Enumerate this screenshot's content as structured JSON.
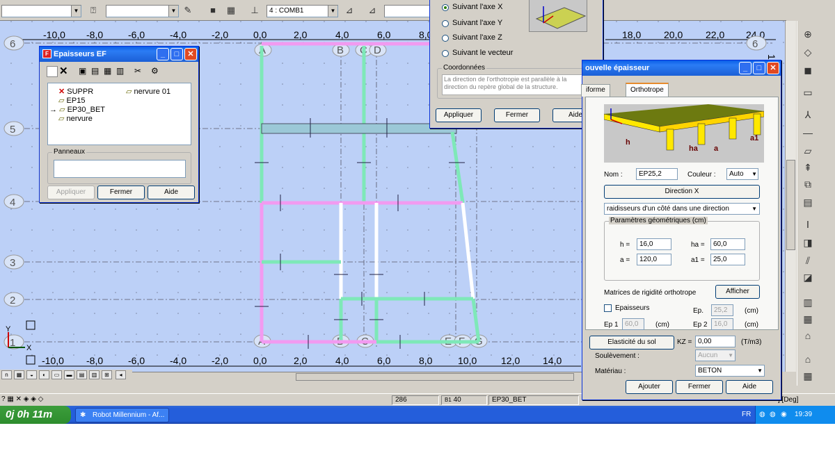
{
  "toolbar": {
    "combo1": "",
    "combo2": "",
    "case_combo": "4 : COMB1"
  },
  "canvas": {
    "top_ruler": [
      "-10,0",
      "-8,0",
      "-6,0",
      "-4,0",
      "-2,0",
      "0,0",
      "2,0",
      "4,0",
      "6,0",
      "8,0",
      "18,0",
      "20,0",
      "22,0",
      "24,0"
    ],
    "bottom_ruler": [
      "-10,0",
      "-8,0",
      "-6,0",
      "-4,0",
      "-2,0",
      "0,0",
      "2,0",
      "4,0",
      "6,0",
      "8,0",
      "10,0",
      "12,0",
      "14,0"
    ],
    "left_axes": [
      "6",
      "5",
      "4",
      "3",
      "2",
      "1"
    ],
    "top_axes": [
      "A",
      "B",
      "C",
      "D",
      "6"
    ],
    "bottom_axes": [
      "A",
      "B",
      "C",
      "E",
      "F",
      "G"
    ],
    "right_ruler_label": "14,"
  },
  "epaisseurs_window": {
    "title": "Epaisseurs EF",
    "items": [
      {
        "label": "SUPPR",
        "icon": "delete-x-icon"
      },
      {
        "label": "nervure 01",
        "icon": "thickness-icon"
      },
      {
        "label": "EP15",
        "icon": "thickness-icon"
      },
      {
        "label": "EP30_BET",
        "icon": "thickness-icon",
        "current": true
      },
      {
        "label": "nervure",
        "icon": "thickness-icon"
      }
    ],
    "panels_label": "Panneaux",
    "panels_value": "",
    "apply": "Appliquer",
    "close": "Fermer",
    "help": "Aide"
  },
  "direction_dialog": {
    "options": [
      "Suivant l'axe X",
      "Suivant l'axe Y",
      "Suivant l'axe Z",
      "Suivant le vecteur"
    ],
    "selected": 0,
    "coords_label": "Coordonnées",
    "coords_text": "La direction de l'orthotropie est parallèle à la direction du repère global de la structure.",
    "apply": "Appliquer",
    "close": "Fermer",
    "help": "Aide"
  },
  "new_thickness": {
    "title": "ouvelle épaisseur",
    "tabs": [
      "iforme",
      "Orthotrope"
    ],
    "active_tab": 1,
    "diagram_labels": {
      "h": "h",
      "ha": "ha",
      "a": "a",
      "a1": "a1"
    },
    "name_label": "Nom :",
    "name_value": "EP25,2",
    "color_label": "Couleur :",
    "color_value": "Auto",
    "direction_button": "Direction X",
    "type_value": "raidisseurs d'un côté dans une direction",
    "geom_label": "Paramètres géométriques (cm)",
    "h_label": "h =",
    "h_value": "16,0",
    "ha_label": "ha =",
    "ha_value": "60,0",
    "a_label": "a =",
    "a_value": "120,0",
    "a1_label": "a1 =",
    "a1_value": "25,0",
    "matrices_label": "Matrices de rigidité orthotrope",
    "show_button": "Afficher",
    "thickness_check": "Epaisseurs",
    "ep_label": "Ep.",
    "ep_value": "25,2",
    "cm1": "(cm)",
    "ep1_label": "Ep 1",
    "ep1_value": "60,0",
    "cm2": "(cm)",
    "ep2_label": "Ep 2",
    "ep2_value": "16,0",
    "cm3": "(cm)",
    "soil_button": "Elasticité du sol",
    "kz_label": "KZ =",
    "kz_value": "0,00",
    "kz_unit": "(T/m3)",
    "uplift_label": "Soulèvement :",
    "uplift_value": "Aucun",
    "material_label": "Matériau :",
    "material_value": "BETON",
    "add": "Ajouter",
    "close": "Fermer",
    "help": "Aide"
  },
  "statusbar": {
    "left_icons": "?",
    "f1": "286",
    "f2": "40",
    "f3": "EP30_BET",
    "right": "] [Deg]"
  },
  "taskbar": {
    "start": "0j 0h 11m",
    "app": "Robot Millennium - Af...",
    "lang": "FR",
    "time": "19:39"
  },
  "colors": {
    "canvas_bg": "#bcd0f7",
    "beam_green": "#7ee8b8",
    "beam_pink": "#f29af0",
    "xp_blue": "#0a5fe8"
  }
}
